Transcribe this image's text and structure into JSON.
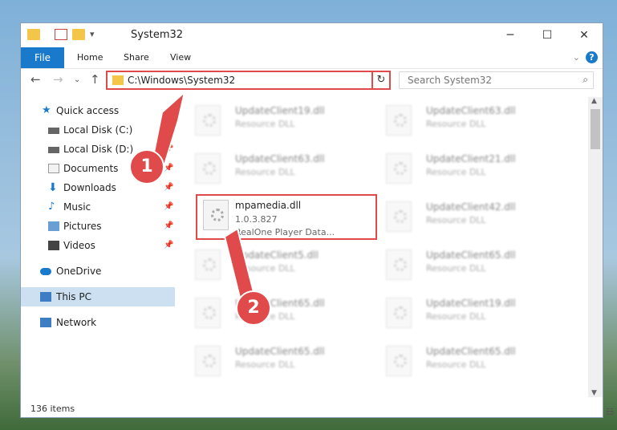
{
  "window": {
    "title": "System32"
  },
  "ribbon": {
    "file": "File",
    "home": "Home",
    "share": "Share",
    "view": "View"
  },
  "address": {
    "path": "C:\\Windows\\System32"
  },
  "search": {
    "placeholder": "Search System32"
  },
  "sidebar": {
    "quick_access": "Quick access",
    "items": [
      "Local Disk (C:)",
      "Local Disk (D:)",
      "Documents",
      "Downloads",
      "Music",
      "Pictures",
      "Videos"
    ],
    "onedrive": "OneDrive",
    "this_pc": "This PC",
    "network": "Network"
  },
  "files": [
    {
      "name": "UpdateClient19.dll",
      "desc": "Resource DLL"
    },
    {
      "name": "UpdateClient63.dll",
      "desc": "Resource DLL"
    },
    {
      "name": "UpdateClient63.dll",
      "desc": "Resource DLL"
    },
    {
      "name": "UpdateClient21.dll",
      "desc": "Resource DLL"
    },
    {
      "name": "mpamedia.dll",
      "version": "1.0.3.827",
      "desc": "RealOne Player Data..."
    },
    {
      "name": "UpdateClient42.dll",
      "desc": "Resource DLL"
    },
    {
      "name": "UpdateClient5.dll",
      "desc": "Resource DLL"
    },
    {
      "name": "UpdateClient65.dll",
      "desc": "Resource DLL"
    },
    {
      "name": "UpdateClient65.dll",
      "desc": "Resource DLL"
    },
    {
      "name": "UpdateClient19.dll",
      "desc": "Resource DLL"
    },
    {
      "name": "UpdateClient65.dll",
      "desc": "Resource DLL"
    },
    {
      "name": "UpdateClient65.dll",
      "desc": "Resource DLL"
    }
  ],
  "status": {
    "count": "136 items"
  },
  "callouts": {
    "one": "1",
    "two": "2"
  },
  "colors": {
    "accent": "#1979ca",
    "highlight": "#e04a4a"
  }
}
